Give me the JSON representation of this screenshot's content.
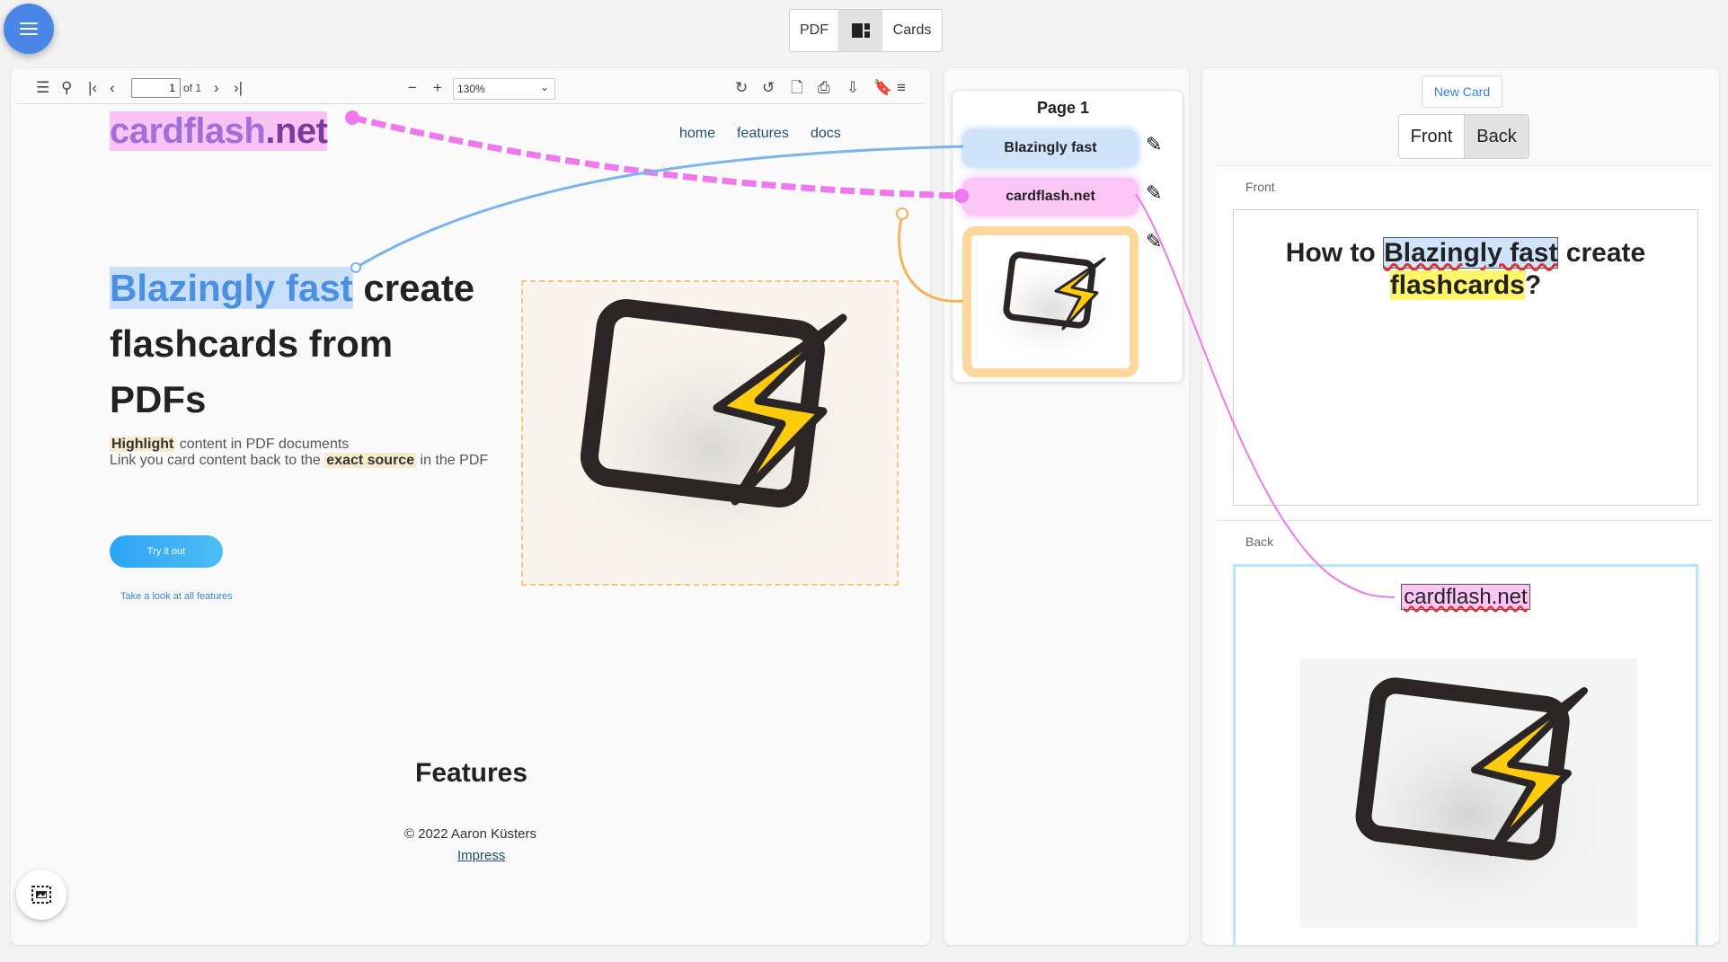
{
  "topbar": {
    "menu_icon": "menu-icon",
    "view_toggle": {
      "pdf_label": "PDF",
      "split_icon": "split-view-icon",
      "cards_label": "Cards"
    }
  },
  "pdf_toolbar": {
    "page_input": "1",
    "page_of": "of 1",
    "zoom": "130%",
    "icons": [
      "sidebar-toggle-icon",
      "search-icon",
      "first-page-icon",
      "prev-page-icon",
      "next-page-icon",
      "last-page-icon",
      "zoom-out-icon",
      "zoom-in-icon",
      "rotate-cw-icon",
      "rotate-ccw-icon",
      "open-file-icon",
      "print-icon",
      "download-icon",
      "bookmark-icon",
      "tools-menu-icon"
    ]
  },
  "pdf_page": {
    "logo_parts": [
      "card",
      "flash",
      ".net"
    ],
    "nav": [
      "home",
      "features",
      "docs"
    ],
    "hero_highlight": "Blazingly fast",
    "hero_rest_1": " create",
    "hero_line_2": "flashcards from",
    "hero_line_3": "PDFs",
    "sub_line1_highlight": "Highlight",
    "sub_line1_rest": " content in PDF documents",
    "sub_line2_pre": "Link you card content back to the ",
    "sub_line2_highlight": "exact source",
    "sub_line2_post": " in the PDF",
    "cta_button": "Try it out",
    "features_link": "Take a look at all features",
    "features_heading": "Features",
    "copyright": "© 2022 Aaron Küsters",
    "impress": "Impress"
  },
  "highlights_panel": {
    "title": "Page 1",
    "items": [
      {
        "label": "Blazingly fast",
        "color": "#cfe3fb"
      },
      {
        "label": "cardflash.net",
        "color": "#fbc6f6"
      },
      {
        "label": "",
        "color": "#fed79d"
      }
    ]
  },
  "card_editor": {
    "new_card": "New Card",
    "tabs": {
      "front": "Front",
      "back": "Back"
    },
    "front_label": "Front",
    "front_pre": "How to ",
    "front_ref": "Blazingly fast",
    "front_mid": " create",
    "front_hl": "flashcards",
    "front_post": "?",
    "back_label": "Back",
    "back_ref": "cardflash.net"
  }
}
